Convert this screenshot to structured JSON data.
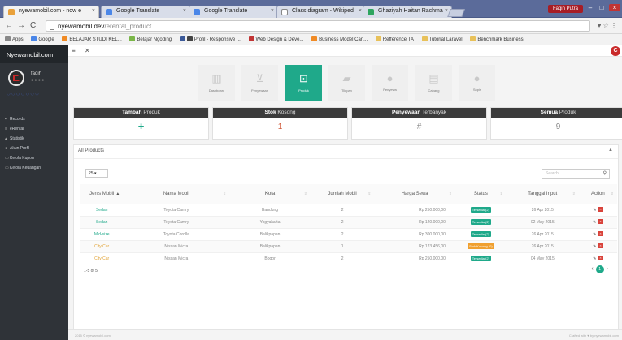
{
  "browser": {
    "tabs": [
      {
        "label": "nyewamobil.com - now e"
      },
      {
        "label": "Google Translate"
      },
      {
        "label": "Google Translate"
      },
      {
        "label": "Class diagram - Wikipedi"
      },
      {
        "label": "Ghaziyah Haitan Rachma"
      }
    ],
    "user": "Faqih Putra",
    "url_host": "nyewamobil.dev",
    "url_path": "/erental_product",
    "bookmarks": [
      {
        "label": "Apps"
      },
      {
        "label": "Google"
      },
      {
        "label": "BELAJAR STUDI KEL..."
      },
      {
        "label": "Belajar Ngoding"
      },
      {
        "label": "Profil - Responsive ..."
      },
      {
        "label": "Web Design & Deve..."
      },
      {
        "label": "Business Model Can..."
      },
      {
        "label": "Refference TA"
      },
      {
        "label": "Tutorial Laravel"
      },
      {
        "label": "Benchmark Business"
      }
    ]
  },
  "sidebar": {
    "brand": "Nyewamobil.com",
    "profile_name": "faqih",
    "profile_status": "● ● ● ●",
    "items": [
      {
        "label": "Records"
      },
      {
        "label": "eRental"
      },
      {
        "label": "Statistik"
      },
      {
        "label": "Akun Profil"
      },
      {
        "label": "Kelola Kupon"
      },
      {
        "label": "Kelola Keuangan"
      }
    ]
  },
  "nav": {
    "tiles": [
      {
        "label": "Dashboard"
      },
      {
        "label": "Penyewaan"
      },
      {
        "label": "Produk"
      },
      {
        "label": "Tikipan"
      },
      {
        "label": "Penyewa"
      },
      {
        "label": "Cabang"
      },
      {
        "label": "Sopir"
      }
    ]
  },
  "cards": [
    {
      "title_b": "Tambah",
      "title": "Produk",
      "value": "+"
    },
    {
      "title_b": "Stok",
      "title": "Kosong",
      "value": "1"
    },
    {
      "title_b": "Penyewaan",
      "title": "Terbanyak",
      "value": "#"
    },
    {
      "title_b": "Semua",
      "title": "Produk",
      "value": "9"
    }
  ],
  "panel": {
    "title": "All Products",
    "page_size": "25",
    "search_placeholder": "Search",
    "columns": [
      "Jenis Mobil",
      "Nama Mobil",
      "Kota",
      "Jumlah Mobil",
      "Harga Sewa",
      "Status",
      "Tanggal Input",
      "Action"
    ],
    "rows": [
      {
        "jenis": "Sedan",
        "nama": "Toyota Camry",
        "kota": "Bandung",
        "jumlah": "2",
        "harga": "Rp 250.000,00",
        "status": "Tersedia (2)",
        "tanggal": "26 Apr 2015"
      },
      {
        "jenis": "Sedan",
        "nama": "Toyota Camry",
        "kota": "Yogyakarta",
        "jumlah": "2",
        "harga": "Rp 120.000,00",
        "status": "Tersedia (2)",
        "tanggal": "02 May 2015"
      },
      {
        "jenis": "Mid-size",
        "nama": "Toyota Corolla",
        "kota": "Balikpapan",
        "jumlah": "2",
        "harga": "Rp 300.000,00",
        "status": "Tersedia (2)",
        "tanggal": "26 Apr 2015"
      },
      {
        "jenis": "City Car",
        "nama": "Nissan Micra",
        "kota": "Balikpapan",
        "jumlah": "1",
        "harga": "Rp 123.456,00",
        "status": "Stok Kosong (0)",
        "tanggal": "26 Apr 2015"
      },
      {
        "jenis": "City Car",
        "nama": "Nissan Micra",
        "kota": "Bogor",
        "jumlah": "2",
        "harga": "Rp 250.000,00",
        "status": "Tersedia (2)",
        "tanggal": "04 May 2015"
      }
    ],
    "info": "1-5 of 5",
    "current_page": "1"
  },
  "footer": {
    "left": "2015 © nyewamobil.com",
    "right": "Crafted with ♥ by nyewamobil.com"
  }
}
